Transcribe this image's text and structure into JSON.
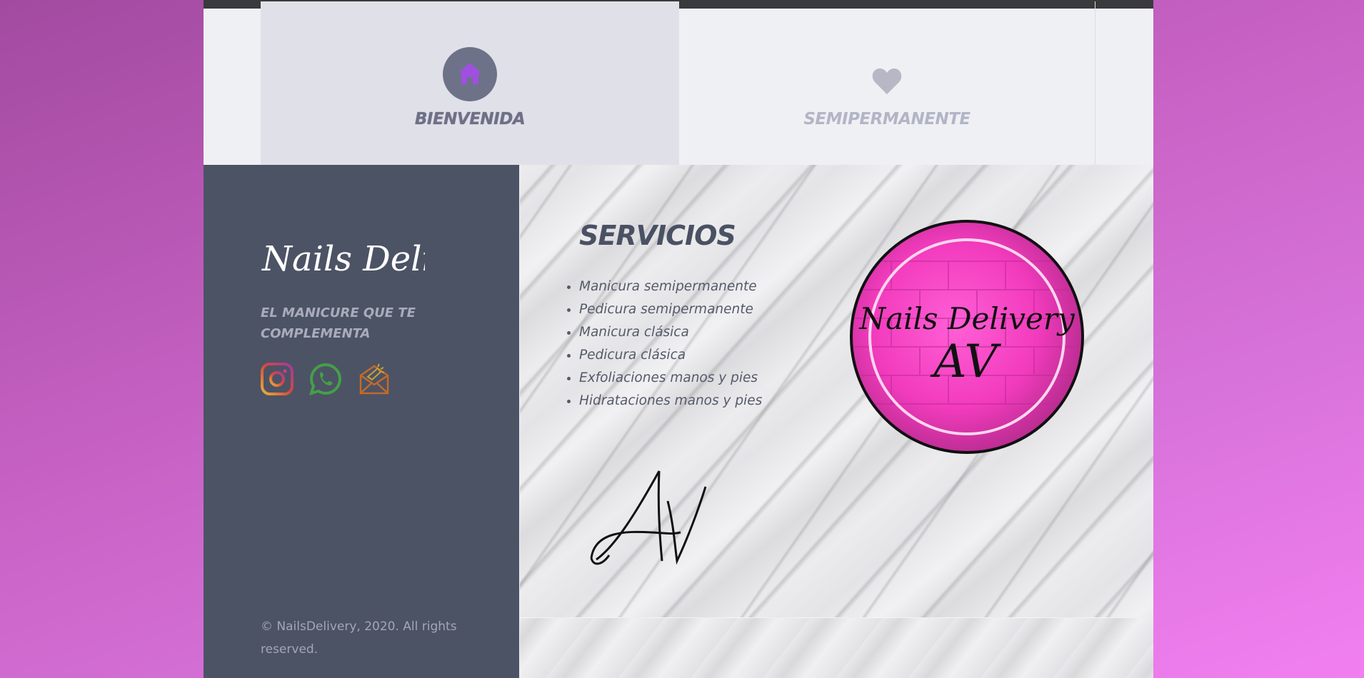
{
  "tabs": [
    {
      "label": "BIENVENIDA",
      "icon": "home-icon",
      "active": true
    },
    {
      "label": "SEMIPERMANENTE",
      "icon": "heart-icon",
      "active": false
    }
  ],
  "sidebar": {
    "brand": "Nails Delivery",
    "tagline": "EL MANICURE QUE TE COMPLEMENTA",
    "socials": [
      {
        "icon": "instagram-icon"
      },
      {
        "icon": "whatsapp-icon"
      },
      {
        "icon": "mail-icon"
      }
    ],
    "copyright": "© NailsDelivery, 2020. All rights reserved."
  },
  "main": {
    "title": "SERVICIOS",
    "services": [
      "Manicura semipermanente",
      "Pedicura semipermanente",
      "Manicura clásica",
      "Pedicura clásica",
      "Exfoliaciones manos y pies",
      "Hidrataciones manos y pies"
    ],
    "logo_text_line1": "Nails Delivery",
    "logo_text_line2": "AV",
    "signature": "AV"
  },
  "colors": {
    "sidebar_bg": "#4c5365",
    "accent_purple": "#9d4ed8",
    "logo_pink": "#ff3fc6"
  }
}
